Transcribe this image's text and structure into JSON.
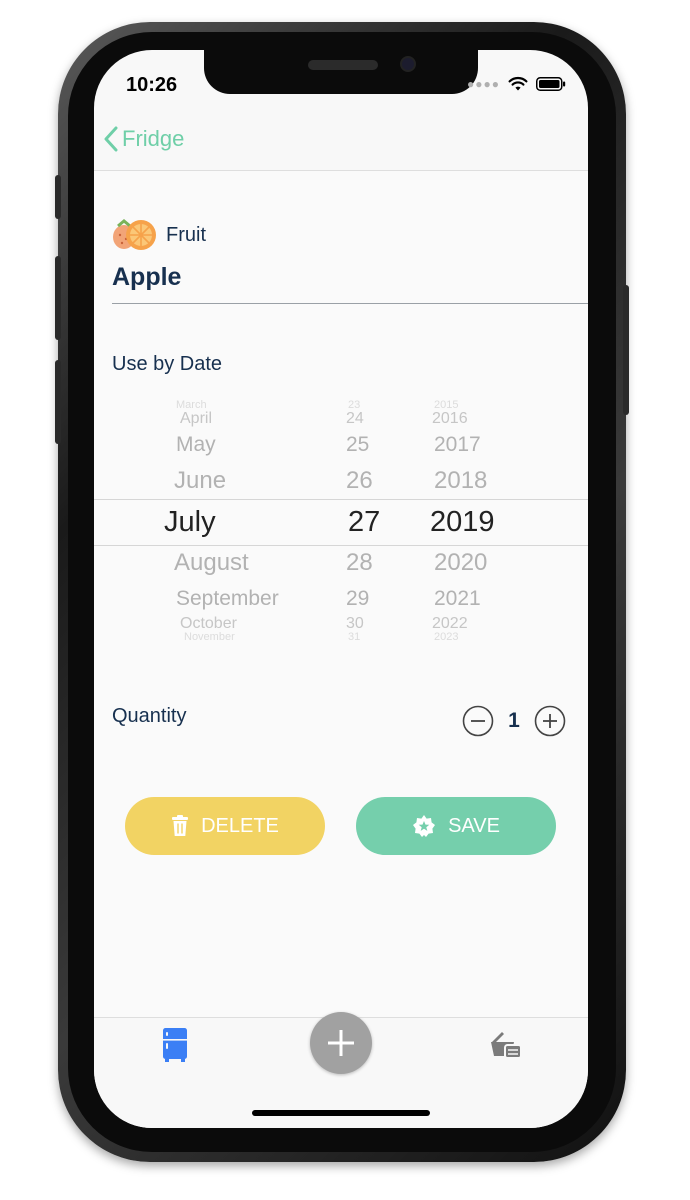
{
  "status_bar": {
    "time": "10:26"
  },
  "nav": {
    "back_label": "Fridge"
  },
  "item": {
    "category": "Fruit",
    "name": "Apple"
  },
  "use_by": {
    "label": "Use by Date",
    "months": [
      "March",
      "April",
      "May",
      "June",
      "July",
      "August",
      "September",
      "October",
      "November"
    ],
    "days": [
      "23",
      "24",
      "25",
      "26",
      "27",
      "28",
      "29",
      "30",
      "31"
    ],
    "years": [
      "2015",
      "2016",
      "2017",
      "2018",
      "2019",
      "2020",
      "2021",
      "2022",
      "2023"
    ],
    "selected": {
      "month": "July",
      "day": "27",
      "year": "2019"
    }
  },
  "quantity": {
    "label": "Quantity",
    "value": "1"
  },
  "actions": {
    "delete_label": "DELETE",
    "save_label": "SAVE"
  },
  "colors": {
    "accent_green": "#75cfac",
    "accent_yellow": "#f2d363",
    "text_navy": "#17304f",
    "tab_active": "#3b7ff5"
  }
}
